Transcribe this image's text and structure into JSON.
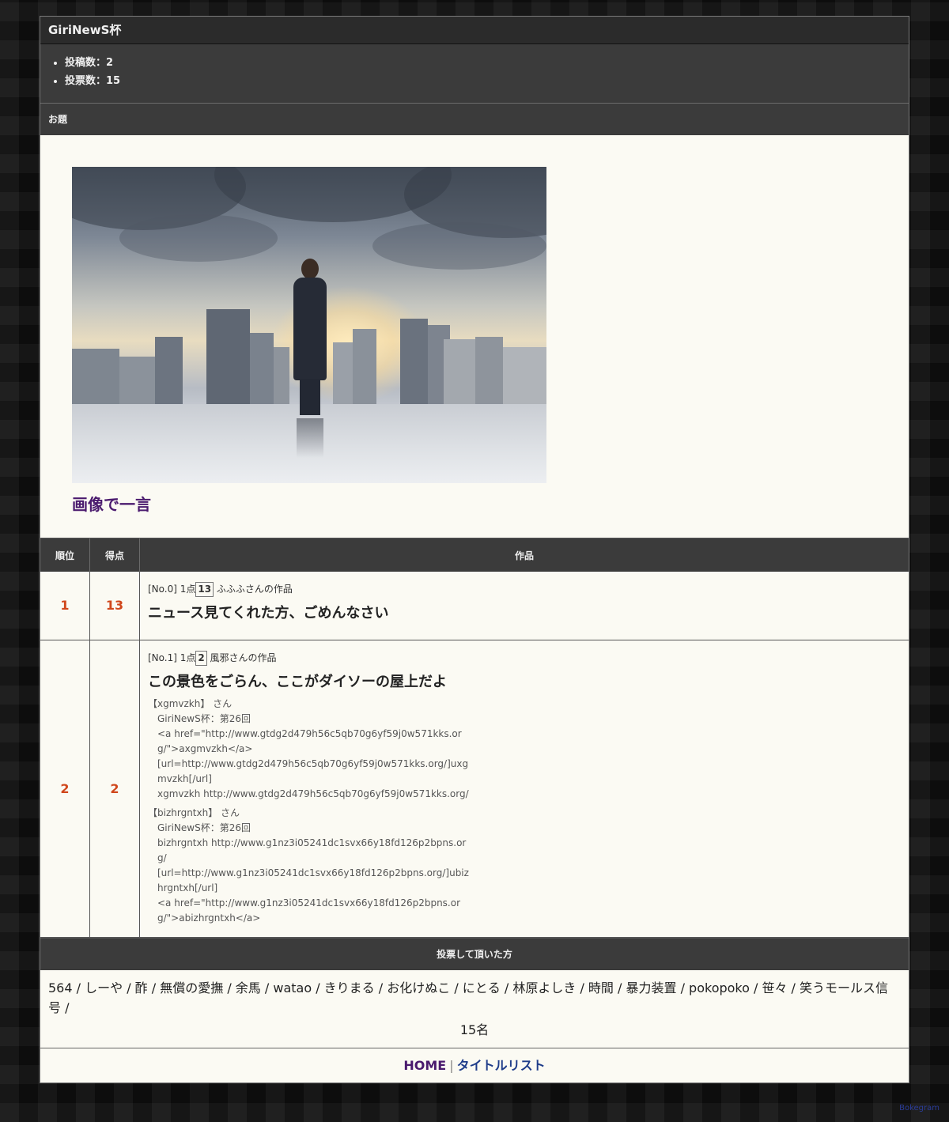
{
  "title": "GiriNewS杯",
  "stats": [
    "投稿数：2",
    "投票数：15"
  ],
  "odai": {
    "heading": "お題",
    "text": "画像で一言"
  },
  "table": {
    "headers": [
      "順位",
      "得点",
      "作品"
    ],
    "rows": [
      {
        "rank": "1",
        "score": "13",
        "meta_prefix": "[No.0] 1点",
        "points": "13",
        "meta_suffix": " ふふふさんの作品",
        "title": "ニュース見てくれた方、ごめんなさい",
        "comments": []
      },
      {
        "rank": "2",
        "score": "2",
        "meta_prefix": "[No.1] 1点",
        "points": "2",
        "meta_suffix": " 風邪さんの作品",
        "title": "この景色をごらん、ここがダイソーの屋上だよ",
        "comments": [
          {
            "name": "【xgmvzkh】 さん",
            "lines": [
              "GiriNewS杯：第26回",
              "<a href=\"http://www.gtdg2d479h56c5qb70g6yf59j0w571kks.org/\">axgmvzkh</a>",
              "[url=http://www.gtdg2d479h56c5qb70g6yf59j0w571kks.org/]uxgmvzkh[/url]",
              "xgmvzkh http://www.gtdg2d479h56c5qb70g6yf59j0w571kks.org/"
            ]
          },
          {
            "name": "【bizhrgntxh】 さん",
            "lines": [
              "GiriNewS杯：第26回",
              "bizhrgntxh http://www.g1nz3i05241dc1svx66y18fd126p2bpns.org/",
              "[url=http://www.g1nz3i05241dc1svx66y18fd126p2bpns.org/]ubizhrgntxh[/url]",
              "<a href=\"http://www.g1nz3i05241dc1svx66y18fd126p2bpns.org/\">abizhrgntxh</a>"
            ]
          }
        ]
      }
    ]
  },
  "voters": {
    "heading": "投票して頂いた方",
    "list": "564 / しーや / 酢 / 無償の愛撫 / 余馬 / watao / きりまる / お化けぬこ / にとる / 林原よしき / 時間 / 暴力装置 / pokopoko / 笹々 / 笑うモールス信号 /",
    "count": "15名"
  },
  "footer": {
    "home": "HOME",
    "separator": "|",
    "list": "タイトルリスト"
  },
  "credit": "Bokegram"
}
